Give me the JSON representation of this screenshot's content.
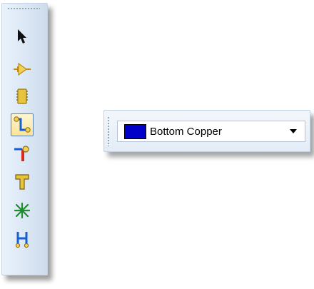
{
  "tool_palette": {
    "tools": [
      {
        "icon": "arrow-select-icon",
        "active": false
      },
      {
        "icon": "component-pin-icon",
        "active": false
      },
      {
        "icon": "ic-chip-icon",
        "active": false
      },
      {
        "icon": "route-track-icon",
        "active": true
      },
      {
        "icon": "via-pad-icon",
        "active": false
      },
      {
        "icon": "t-junction-icon",
        "active": false
      },
      {
        "icon": "ratsnest-star-icon",
        "active": false
      },
      {
        "icon": "bus-connector-icon",
        "active": false
      }
    ]
  },
  "layer_toolbar": {
    "selected_layer": "Bottom Copper",
    "swatch_color": "#0000c8"
  },
  "colors": {
    "palette_bg": "#dfeaf7",
    "active_highlight": "#fbe39a",
    "icon_yellow": "#e8c43c",
    "icon_red": "#d62a1f",
    "icon_green": "#1f8c2e",
    "icon_blue": "#1a5fd0"
  }
}
